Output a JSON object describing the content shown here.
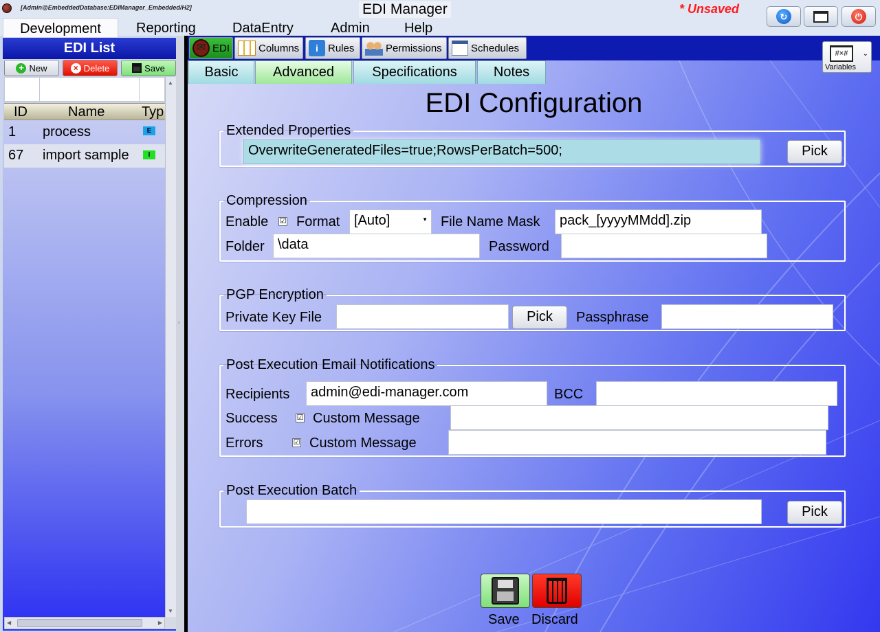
{
  "title_bar": {
    "connection": "[Admin@EmbeddedDatabase:EDIManager_Embedded/H2]",
    "app_title": "EDI Manager",
    "unsaved": "* Unsaved"
  },
  "menu": [
    "Development",
    "Reporting",
    "DataEntry",
    "Admin",
    "Help"
  ],
  "left_panel": {
    "title": "EDI List",
    "buttons": {
      "new": "New",
      "delete": "Delete",
      "save": "Save"
    },
    "columns": [
      "ID",
      "Name",
      "Typ"
    ],
    "rows": [
      {
        "id": "1",
        "name": "process",
        "type": "E",
        "type_color": "#1aa3e8"
      },
      {
        "id": "67",
        "name": "import sample",
        "type": "I",
        "type_color": "#22e022"
      }
    ]
  },
  "top_tabs": [
    "EDI",
    "Columns",
    "Rules",
    "Permissions",
    "Schedules"
  ],
  "sub_tabs": [
    "Basic",
    "Advanced",
    "Specifications",
    "Notes"
  ],
  "variables": {
    "icon_text": "#×#",
    "label": "Variables"
  },
  "page_title": "EDI Configuration",
  "extended": {
    "legend": "Extended Properties",
    "value": "OverwriteGeneratedFiles=true;RowsPerBatch=500;",
    "pick": "Pick"
  },
  "compression": {
    "legend": "Compression",
    "enable_label": "Enable",
    "enable_checked": "☑",
    "format_label": "Format",
    "format_value": "[Auto]",
    "mask_label": "File Name Mask",
    "mask_value": "pack_[yyyyMMdd].zip",
    "folder_label": "Folder",
    "folder_value": "\\data",
    "password_label": "Password",
    "password_value": ""
  },
  "pgp": {
    "legend": "PGP Encryption",
    "key_label": "Private Key File",
    "key_value": "",
    "pick": "Pick",
    "passphrase_label": "Passphrase",
    "passphrase_value": ""
  },
  "email": {
    "legend": "Post Execution Email Notifications",
    "recipients_label": "Recipients",
    "recipients_value": "admin@edi-manager.com",
    "bcc_label": "BCC",
    "bcc_value": "",
    "success_label": "Success",
    "errors_label": "Errors",
    "custom_label": "Custom Message",
    "check_mark": "☑",
    "success_msg": "",
    "errors_msg": ""
  },
  "batch": {
    "legend": "Post Execution Batch",
    "value": "",
    "pick": "Pick"
  },
  "footer": {
    "save": "Save",
    "discard": "Discard"
  }
}
